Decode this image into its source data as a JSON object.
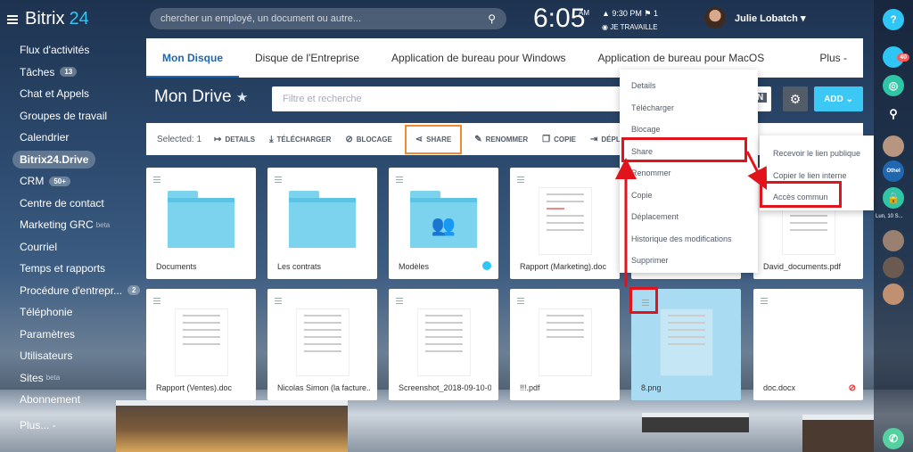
{
  "app": {
    "name_part1": "Bitrix",
    "name_part2": "24"
  },
  "sidebar": {
    "items": [
      {
        "label": "Flux d'activités"
      },
      {
        "label": "Tâches",
        "count": "13"
      },
      {
        "label": "Chat et Appels"
      },
      {
        "label": "Groupes de travail"
      },
      {
        "label": "Calendrier"
      },
      {
        "label": "Bitrix24.Drive",
        "active": true
      },
      {
        "label": "CRM",
        "count": "50+"
      },
      {
        "label": "Centre de contact"
      },
      {
        "label": "Marketing GRC",
        "beta": "beta"
      },
      {
        "label": "Courriel"
      },
      {
        "label": "Temps et rapports"
      },
      {
        "label": "Procédure d'entrepr...",
        "count": "2"
      },
      {
        "label": "Téléphonie"
      },
      {
        "label": "Paramètres"
      },
      {
        "label": "Utilisateurs"
      },
      {
        "label": "Sites",
        "beta": "beta"
      },
      {
        "label": "Abonnement"
      },
      {
        "label": "Plus... -"
      }
    ]
  },
  "header": {
    "search_placeholder": "chercher un employé, un document ou autre...",
    "time": "6:05",
    "ampm": "AM",
    "alarm": "▲ 9:30 PM  ⚑ 1",
    "status": "◉ JE TRAVAILLE",
    "username": "Julie Lobatch",
    "username_arrow": "▾"
  },
  "tabs": [
    {
      "label": "Mon Disque",
      "active": true
    },
    {
      "label": "Disque de l'Entreprise"
    },
    {
      "label": "Application de bureau pour Windows"
    },
    {
      "label": "Application de bureau pour MacOS"
    },
    {
      "label": "Plus -"
    }
  ],
  "page": {
    "title": "Mon Drive",
    "star": "★",
    "filter_placeholder": "Filtre et recherche",
    "filter_tail": "N",
    "add_label": "ADD ⌄"
  },
  "toolbar": {
    "selected": "Selected: 1",
    "details": "DETAILS",
    "download": "TÉLÉCHARGER",
    "lock": "BLOCAGE",
    "share": "SHARE",
    "rename": "RENOMMER",
    "copy": "COPIE",
    "move": "DÉPLA"
  },
  "files": [
    {
      "name": "Documents",
      "kind": "folder"
    },
    {
      "name": "Les contrats",
      "kind": "folder"
    },
    {
      "name": "Modèles",
      "kind": "folder-shared"
    },
    {
      "name": "Rapport (Marketing).doc",
      "kind": "doc"
    },
    {
      "name": "",
      "kind": "hidden"
    },
    {
      "name": "David_documents.pdf",
      "kind": "doc"
    },
    {
      "name": "Rapport (Ventes).doc",
      "kind": "doc"
    },
    {
      "name": "Nicolas Simon (la facture...",
      "kind": "doc"
    },
    {
      "name": "Screenshot_2018-09-10-0...",
      "kind": "doc"
    },
    {
      "name": "!!!.pdf",
      "kind": "doc"
    },
    {
      "name": "8.png",
      "kind": "image-selected"
    },
    {
      "name": "doc.docx",
      "kind": "doc-blocked"
    }
  ],
  "context_menu": {
    "items": [
      "Details",
      "Télécharger",
      "Blocage",
      "Share",
      "Renommer",
      "Copie",
      "Déplacement",
      "Historique des modifications",
      "Supprimer"
    ]
  },
  "share_submenu": {
    "items": [
      "Recevoir le lien publique",
      "Copier le lien interne",
      "Accès commun"
    ]
  },
  "right_rail": {
    "help": "?",
    "notif_count": "40",
    "date": "Lun, 10 S..."
  },
  "colors": {
    "accent": "#2067b0",
    "add_button": "#3bc8f5",
    "highlight": "#e0141a",
    "share_outline": "#f28b30"
  }
}
